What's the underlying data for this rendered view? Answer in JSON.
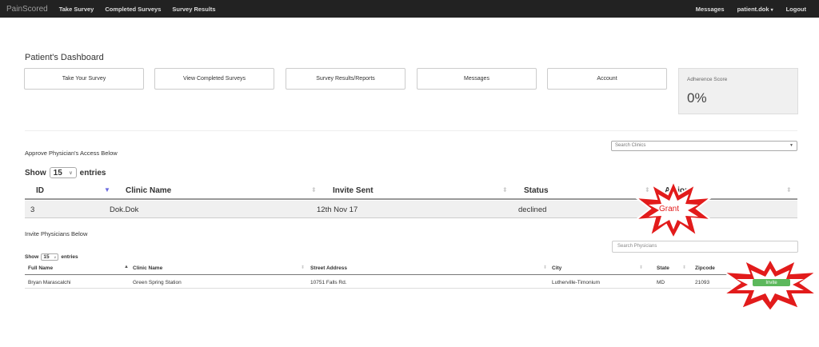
{
  "navbar": {
    "brand": "PainScored",
    "links": [
      "Take Survey",
      "Completed Surveys",
      "Survey Results"
    ],
    "messages": "Messages",
    "user": "patient.dok",
    "logout": "Logout"
  },
  "page_title": "Patient's Dashboard",
  "dashboard_buttons": [
    "Take Your Survey",
    "View Completed Surveys",
    "Survey Results/Reports",
    "Messages",
    "Account"
  ],
  "adherence": {
    "label": "Adherence Score",
    "value": "0%"
  },
  "approve_section": {
    "title": "Approve Physician's Access Below",
    "search_placeholder": "Search Clinics",
    "show_label": "Show",
    "entries_value": "15",
    "entries_label": "entries",
    "columns": [
      "ID",
      "Clinic Name",
      "Invite Sent",
      "Status",
      "Action"
    ],
    "rows": [
      {
        "id": "3",
        "clinic": "Dok.Dok",
        "invite_sent": "12th Nov 17",
        "status": "declined",
        "action": "Grant"
      }
    ]
  },
  "invite_section": {
    "title": "Invite Physicians Below",
    "search_placeholder": "Search Physicians",
    "show_label": "Show",
    "entries_value": "15",
    "entries_label": "entries",
    "columns": [
      "Full Name",
      "Clinic Name",
      "Street Address",
      "City",
      "State",
      "Zipcode"
    ],
    "rows": [
      {
        "name": "Bryan Marascalchi",
        "clinic": "Green Spring Station",
        "address": "10751 Falls Rd.",
        "city": "Lutherville-Timonium",
        "state": "MD",
        "zip": "21093",
        "action": "Invite"
      }
    ]
  },
  "colors": {
    "accent_green": "#5cb85c",
    "highlight_red": "#e21b1b",
    "navbar": "#222222"
  }
}
